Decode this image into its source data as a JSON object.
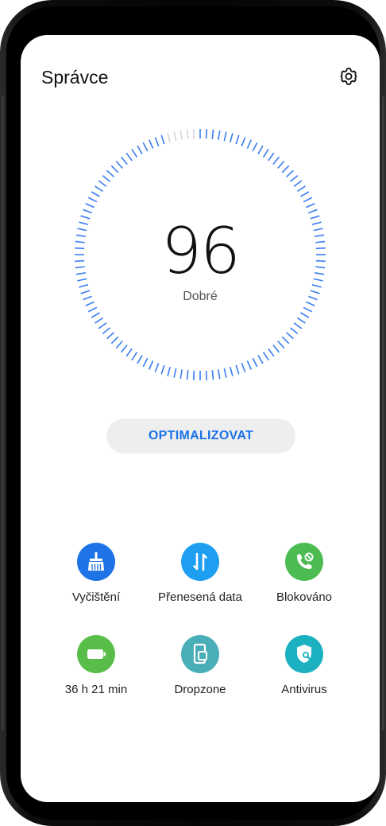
{
  "header": {
    "title": "Správce",
    "settings_icon": "gear-icon"
  },
  "score": {
    "value": "96",
    "label": "Dobré",
    "gauge_fill_fraction": 0.96
  },
  "optimize_button": {
    "label": "OPTIMALIZOVAT"
  },
  "tools": [
    {
      "label": "Vyčištění",
      "icon": "broom-icon",
      "color": "#1e74e6"
    },
    {
      "label": "Přenesená data",
      "icon": "data-transfer-icon",
      "color": "#1d9ef0"
    },
    {
      "label": "Blokováno",
      "icon": "blocked-call-icon",
      "color": "#4cbc52"
    },
    {
      "label": "36 h 21 min",
      "icon": "battery-icon",
      "color": "#59be49"
    },
    {
      "label": "Dropzone",
      "icon": "dropzone-icon",
      "color": "#49aeb7"
    },
    {
      "label": "Antivirus",
      "icon": "shield-scan-icon",
      "color": "#1bb1c0"
    }
  ],
  "colors": {
    "accent": "#1a73e8",
    "gauge_tick": "#3a7ef0",
    "gauge_tick_inactive": "#d6d6d6"
  }
}
